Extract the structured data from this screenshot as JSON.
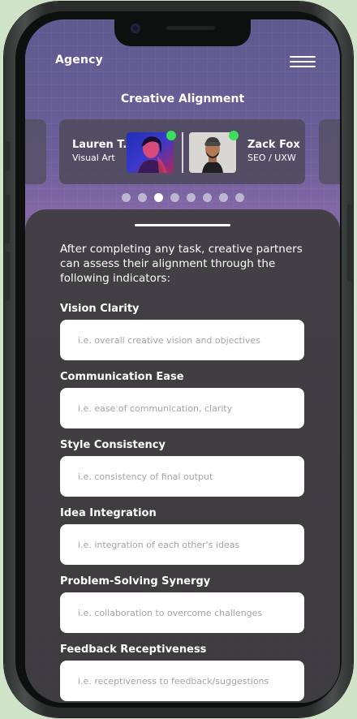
{
  "app": {
    "brand": "Agency"
  },
  "section_title": "Creative Alignment",
  "carousel": {
    "partners": [
      {
        "name": "Lauren T.",
        "role": "Visual Art",
        "online": true
      },
      {
        "name": "Zack Fox",
        "role": "SEO / UXW",
        "online": true
      }
    ],
    "page_count": 8,
    "active_index": 2
  },
  "intro": "After completing any task, creative partners can assess their alignment through the following indicators:",
  "indicators": [
    {
      "label": "Vision Clarity",
      "placeholder": "i.e. overall creative vision and objectives"
    },
    {
      "label": "Communication Ease",
      "placeholder": "i.e. ease of communication, clarity"
    },
    {
      "label": "Style Consistency",
      "placeholder": "i.e. consistency of final output"
    },
    {
      "label": "Idea Integration",
      "placeholder": "i.e. integration of each other's ideas"
    },
    {
      "label": "Problem-Solving Synergy",
      "placeholder": "i.e. collaboration to overcome challenges"
    },
    {
      "label": "Feedback Receptiveness",
      "placeholder": "i.e. receptiveness to feedback/suggestions"
    }
  ],
  "colors": {
    "online": "#39e05a",
    "background": "#cfe3c9",
    "accent_purple": "#8467a6"
  }
}
